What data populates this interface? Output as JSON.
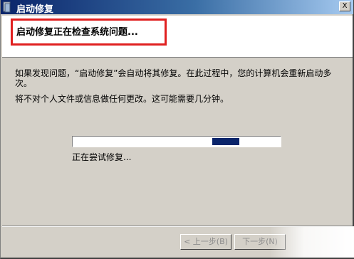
{
  "window": {
    "title": "启动修复",
    "close_label": "X"
  },
  "header": {
    "title": "启动修复正在检查系统问题..."
  },
  "body": {
    "description_1": "如果发现问题，“启动修复”会自动将其修复。在此过程中，您的计算机会重新启动多次。",
    "description_2": "将不对个人文件或信息做任何更改。这可能需要几分钟。"
  },
  "progress": {
    "style": "marquee",
    "status": "正在尝试修复..."
  },
  "footer": {
    "back_label": "< 上一步(B)",
    "next_label": "下一步(N)"
  },
  "colors": {
    "titlebar": "#0a246a",
    "progress_chunk": "#0a246a",
    "highlight": "#e02020"
  }
}
